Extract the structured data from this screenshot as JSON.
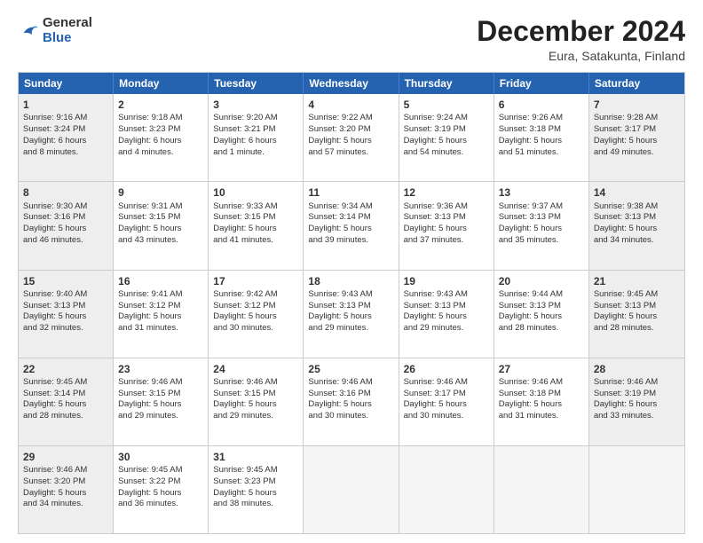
{
  "header": {
    "logo": {
      "general": "General",
      "blue": "Blue"
    },
    "title": "December 2024",
    "subtitle": "Eura, Satakunta, Finland"
  },
  "calendar": {
    "days_of_week": [
      "Sunday",
      "Monday",
      "Tuesday",
      "Wednesday",
      "Thursday",
      "Friday",
      "Saturday"
    ],
    "weeks": [
      [
        {
          "day": "",
          "info": "",
          "empty": true
        },
        {
          "day": "2",
          "info": "Sunrise: 9:18 AM\nSunset: 3:23 PM\nDaylight: 6 hours\nand 4 minutes.",
          "shaded": false
        },
        {
          "day": "3",
          "info": "Sunrise: 9:20 AM\nSunset: 3:21 PM\nDaylight: 6 hours\nand 1 minute.",
          "shaded": false
        },
        {
          "day": "4",
          "info": "Sunrise: 9:22 AM\nSunset: 3:20 PM\nDaylight: 5 hours\nand 57 minutes.",
          "shaded": false
        },
        {
          "day": "5",
          "info": "Sunrise: 9:24 AM\nSunset: 3:19 PM\nDaylight: 5 hours\nand 54 minutes.",
          "shaded": false
        },
        {
          "day": "6",
          "info": "Sunrise: 9:26 AM\nSunset: 3:18 PM\nDaylight: 5 hours\nand 51 minutes.",
          "shaded": false
        },
        {
          "day": "7",
          "info": "Sunrise: 9:28 AM\nSunset: 3:17 PM\nDaylight: 5 hours\nand 49 minutes.",
          "shaded": true
        }
      ],
      [
        {
          "day": "1",
          "info": "Sunrise: 9:16 AM\nSunset: 3:24 PM\nDaylight: 6 hours\nand 8 minutes.",
          "shaded": true,
          "week1sunday": true
        },
        {
          "day": "9",
          "info": "Sunrise: 9:31 AM\nSunset: 3:15 PM\nDaylight: 5 hours\nand 43 minutes.",
          "shaded": false
        },
        {
          "day": "10",
          "info": "Sunrise: 9:33 AM\nSunset: 3:15 PM\nDaylight: 5 hours\nand 41 minutes.",
          "shaded": false
        },
        {
          "day": "11",
          "info": "Sunrise: 9:34 AM\nSunset: 3:14 PM\nDaylight: 5 hours\nand 39 minutes.",
          "shaded": false
        },
        {
          "day": "12",
          "info": "Sunrise: 9:36 AM\nSunset: 3:13 PM\nDaylight: 5 hours\nand 37 minutes.",
          "shaded": false
        },
        {
          "day": "13",
          "info": "Sunrise: 9:37 AM\nSunset: 3:13 PM\nDaylight: 5 hours\nand 35 minutes.",
          "shaded": false
        },
        {
          "day": "14",
          "info": "Sunrise: 9:38 AM\nSunset: 3:13 PM\nDaylight: 5 hours\nand 34 minutes.",
          "shaded": true
        }
      ],
      [
        {
          "day": "8",
          "info": "Sunrise: 9:30 AM\nSunset: 3:16 PM\nDaylight: 5 hours\nand 46 minutes.",
          "shaded": true,
          "week2sunday": true
        },
        {
          "day": "16",
          "info": "Sunrise: 9:41 AM\nSunset: 3:12 PM\nDaylight: 5 hours\nand 31 minutes.",
          "shaded": false
        },
        {
          "day": "17",
          "info": "Sunrise: 9:42 AM\nSunset: 3:12 PM\nDaylight: 5 hours\nand 30 minutes.",
          "shaded": false
        },
        {
          "day": "18",
          "info": "Sunrise: 9:43 AM\nSunset: 3:13 PM\nDaylight: 5 hours\nand 29 minutes.",
          "shaded": false
        },
        {
          "day": "19",
          "info": "Sunrise: 9:43 AM\nSunset: 3:13 PM\nDaylight: 5 hours\nand 29 minutes.",
          "shaded": false
        },
        {
          "day": "20",
          "info": "Sunrise: 9:44 AM\nSunset: 3:13 PM\nDaylight: 5 hours\nand 28 minutes.",
          "shaded": false
        },
        {
          "day": "21",
          "info": "Sunrise: 9:45 AM\nSunset: 3:13 PM\nDaylight: 5 hours\nand 28 minutes.",
          "shaded": true
        }
      ],
      [
        {
          "day": "15",
          "info": "Sunrise: 9:40 AM\nSunset: 3:13 PM\nDaylight: 5 hours\nand 32 minutes.",
          "shaded": true,
          "week3sunday": true
        },
        {
          "day": "23",
          "info": "Sunrise: 9:46 AM\nSunset: 3:15 PM\nDaylight: 5 hours\nand 29 minutes.",
          "shaded": false
        },
        {
          "day": "24",
          "info": "Sunrise: 9:46 AM\nSunset: 3:15 PM\nDaylight: 5 hours\nand 29 minutes.",
          "shaded": false
        },
        {
          "day": "25",
          "info": "Sunrise: 9:46 AM\nSunset: 3:16 PM\nDaylight: 5 hours\nand 30 minutes.",
          "shaded": false
        },
        {
          "day": "26",
          "info": "Sunrise: 9:46 AM\nSunset: 3:17 PM\nDaylight: 5 hours\nand 30 minutes.",
          "shaded": false
        },
        {
          "day": "27",
          "info": "Sunrise: 9:46 AM\nSunset: 3:18 PM\nDaylight: 5 hours\nand 31 minutes.",
          "shaded": false
        },
        {
          "day": "28",
          "info": "Sunrise: 9:46 AM\nSunset: 3:19 PM\nDaylight: 5 hours\nand 33 minutes.",
          "shaded": true
        }
      ],
      [
        {
          "day": "22",
          "info": "Sunrise: 9:45 AM\nSunset: 3:14 PM\nDaylight: 5 hours\nand 28 minutes.",
          "shaded": true,
          "week4sunday": true
        },
        {
          "day": "30",
          "info": "Sunrise: 9:45 AM\nSunset: 3:22 PM\nDaylight: 5 hours\nand 36 minutes.",
          "shaded": false
        },
        {
          "day": "31",
          "info": "Sunrise: 9:45 AM\nSunset: 3:23 PM\nDaylight: 5 hours\nand 38 minutes.",
          "shaded": false
        },
        {
          "day": "",
          "info": "",
          "empty": true
        },
        {
          "day": "",
          "info": "",
          "empty": true
        },
        {
          "day": "",
          "info": "",
          "empty": true
        },
        {
          "day": "",
          "info": "",
          "empty": true,
          "shaded": true
        }
      ]
    ],
    "week1": {
      "sunday": {
        "day": "1",
        "info": "Sunrise: 9:16 AM\nSunset: 3:24 PM\nDaylight: 6 hours\nand 8 minutes."
      }
    }
  }
}
